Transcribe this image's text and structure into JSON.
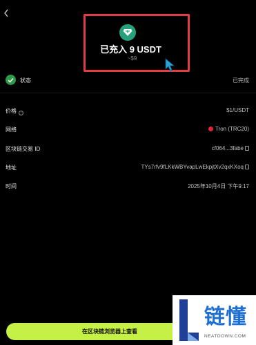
{
  "header": {
    "back_icon": "chevron-left-icon",
    "token_icon": "usdt-diamond-icon",
    "title": "已充入 9 USDT",
    "subtitle": "~$9"
  },
  "status": {
    "label": "状态",
    "value": "已完成",
    "icon": "check-circle-icon",
    "color": "#2e9b4a"
  },
  "details": [
    {
      "key": "价格",
      "value": "$1/USDT",
      "info_icon": "ⓘ"
    },
    {
      "key": "网络",
      "value": "Tron (TRC20)"
    },
    {
      "key": "区块链交易 ID",
      "value": "cf064...3fabe"
    },
    {
      "key": "地址",
      "value": "TYs7rfv9fLKkWBYvapLwEkpjtXv2qxKXoq"
    },
    {
      "key": "时间",
      "value": "2025年10月4日 下午9:17"
    }
  ],
  "cta": {
    "label": "在区块链浏览器上查看",
    "color": "#c5f046"
  },
  "watermark": {
    "cn": "链懂",
    "en": "NEATDOWN.COM"
  },
  "colors": {
    "background": "#000000",
    "highlight": "#e23c46",
    "usdt": "#26a17b",
    "tron": "#e5243b"
  }
}
